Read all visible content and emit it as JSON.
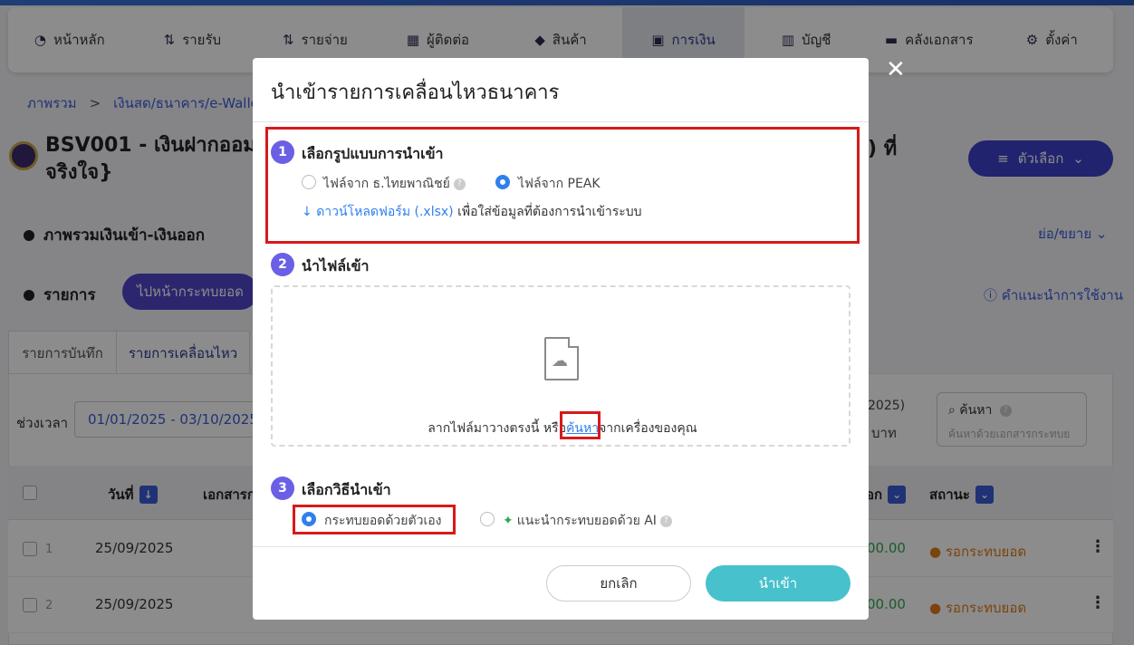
{
  "nav": {
    "items": [
      {
        "label": "หน้าหลัก",
        "icon": "dashboard-icon"
      },
      {
        "label": "รายรับ",
        "icon": "income-icon"
      },
      {
        "label": "รายจ่าย",
        "icon": "expense-icon"
      },
      {
        "label": "ผู้ติดต่อ",
        "icon": "contacts-icon"
      },
      {
        "label": "สินค้า",
        "icon": "box-icon"
      },
      {
        "label": "การเงิน",
        "icon": "money-icon",
        "active": true
      },
      {
        "label": "บัญชี",
        "icon": "ledger-icon"
      },
      {
        "label": "คลังเอกสาร",
        "icon": "folder-icon"
      },
      {
        "label": "ตั้งค่า",
        "icon": "gear-icon"
      }
    ]
  },
  "breadcrumb": {
    "home": "ภาพรวม",
    "separator": ">",
    "current": "เงินสด/ธนาคาร/e-Walle"
  },
  "account": {
    "title": "BSV001 - เงินฝากออม",
    "title_line2": "จริงใจ}",
    "title_tail": ") ที่"
  },
  "options_button": "ตัวเลือก",
  "overview": {
    "title": "ภาพรวมเงินเข้า-เงินออก",
    "collapse": "ย่อ/ขยาย"
  },
  "transactions": {
    "title": "รายการ",
    "goto_reconcile": "ไปหน้ากระทบยอด",
    "help": "คำแนะนำการใช้งาน",
    "tabs": [
      "รายการบันทึก",
      "รายการเคลื่อนไหว"
    ],
    "period_label": "ช่วงเวลา",
    "period_value": "01/01/2025 - 03/10/2025",
    "partial_year": "2025)",
    "partial_unit": "บาท",
    "search_label": "ค้นหา",
    "search_placeholder": "ค้นหาด้วยเอกสารกระทบย",
    "columns": {
      "date": "วันที่",
      "doc": "เอกสารก",
      "amount_tail": "อก",
      "status": "สถานะ"
    },
    "rows": [
      {
        "index": "1",
        "date": "25/09/2025",
        "amount": "00.00",
        "status": "รอกระทบยอด"
      },
      {
        "index": "2",
        "date": "25/09/2025",
        "amount": "00.00",
        "status": "รอกระทบยอด"
      }
    ]
  },
  "modal": {
    "title": "นำเข้ารายการเคลื่อนไหวธนาคาร",
    "close": "✕",
    "step1": {
      "num": "1",
      "label": "เลือกรูปแบบการนำเข้า",
      "option_a": "ไฟล์จาก ธ.ไทยพาณิชย์",
      "option_b": "ไฟล์จาก PEAK",
      "download_link": "ดาวน์โหลดฟอร์ม (.xlsx)",
      "download_text": "เพื่อใส่ข้อมูลที่ต้องการนำเข้าระบบ"
    },
    "step2": {
      "num": "2",
      "label": "นำไฟล์เข้า",
      "drop_text": "ลากไฟล์มาวางตรงนี้ หรือ",
      "browse": "ค้นหา",
      "drop_text_tail": "จากเครื่องของคุณ"
    },
    "step3": {
      "num": "3",
      "label": "เลือกวิธีนำเข้า",
      "option_a": "กระทบยอดด้วยตัวเอง",
      "option_b": "แนะนำกระทบยอดด้วย AI"
    },
    "cancel": "ยกเลิก",
    "import": "นำเข้า"
  },
  "colors": {
    "accent": "#3d40c9",
    "highlight": "#d61a1a",
    "import_button": "#47c1cc",
    "status_pending": "#e07b1a"
  }
}
